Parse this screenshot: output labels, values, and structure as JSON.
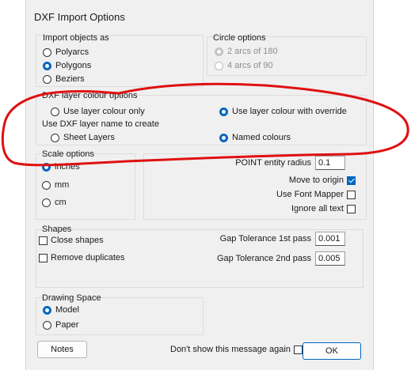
{
  "window": {
    "title": "DXF Import Options"
  },
  "import_objects": {
    "label": "Import objects as",
    "options": [
      {
        "label": "Polyarcs",
        "selected": false
      },
      {
        "label": "Polygons",
        "selected": true
      },
      {
        "label": "Beziers",
        "selected": false
      }
    ]
  },
  "circle_options": {
    "label": "Circle options",
    "options": [
      {
        "label": "2 arcs of 180",
        "selected": true,
        "disabled": true
      },
      {
        "label": "4 arcs of 90",
        "selected": false,
        "disabled": true
      }
    ]
  },
  "layer_colour": {
    "label": "DXF layer colour options",
    "use_layer_colour_only": "Use layer colour only",
    "use_layer_colour_override": "Use layer colour with override",
    "layer_name_label": "Use DXF layer name to create",
    "sheet_layers": "Sheet Layers",
    "named_colours": "Named colours"
  },
  "scale_options": {
    "label": "Scale options",
    "options": [
      {
        "label": "inches",
        "selected": true
      },
      {
        "label": "mm",
        "selected": false
      },
      {
        "label": "cm",
        "selected": false
      }
    ]
  },
  "right_options": {
    "point_radius_label": "POINT entity radius",
    "point_radius_value": "0.1",
    "move_to_origin": "Move to origin",
    "use_font_mapper": "Use Font Mapper",
    "ignore_all_text": "Ignore all text"
  },
  "shapes": {
    "label": "Shapes",
    "close_shapes": "Close shapes",
    "remove_duplicates": "Remove duplicates",
    "gap1_label": "Gap Tolerance 1st pass",
    "gap1_value": "0.001",
    "gap2_label": "Gap Tolerance 2nd pass",
    "gap2_value": "0.005"
  },
  "drawing_space": {
    "label": "Drawing Space",
    "options": [
      {
        "label": "Model",
        "selected": true
      },
      {
        "label": "Paper",
        "selected": false
      }
    ]
  },
  "footer": {
    "notes": "Notes",
    "dont_show": "Don't show this message again",
    "ok": "OK"
  },
  "colors": {
    "accent": "#0067c0",
    "annotation": "#e01010"
  }
}
